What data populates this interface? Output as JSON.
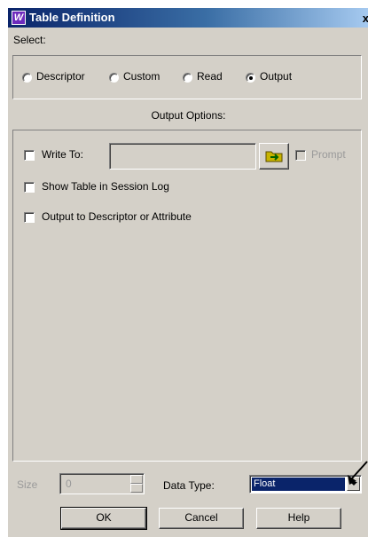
{
  "window": {
    "title": "Table Definition",
    "close_glyph": "x"
  },
  "select": {
    "label": "Select:",
    "options": [
      {
        "label": "Descriptor",
        "selected": false
      },
      {
        "label": "Custom",
        "selected": false
      },
      {
        "label": "Read",
        "selected": false
      },
      {
        "label": "Output",
        "selected": true
      }
    ]
  },
  "output_options": {
    "heading": "Output Options:",
    "write_to_label": "Write To:",
    "write_to_value": "",
    "prompt_label": "Prompt",
    "show_table_label": "Show Table in Session Log",
    "output_descriptor_label": "Output to Descriptor or Attribute"
  },
  "bottom": {
    "size_label": "Size",
    "size_value": "0",
    "data_type_label": "Data Type:",
    "data_type_value": "Float"
  },
  "buttons": {
    "ok": "OK",
    "cancel": "Cancel",
    "help": "Help"
  },
  "icons": {
    "app": "table-app-icon",
    "browse": "folder-browse-icon"
  },
  "colors": {
    "titlebar_start": "#0a246a",
    "dialog_face": "#d4d0c8",
    "selection": "#0a246a"
  }
}
